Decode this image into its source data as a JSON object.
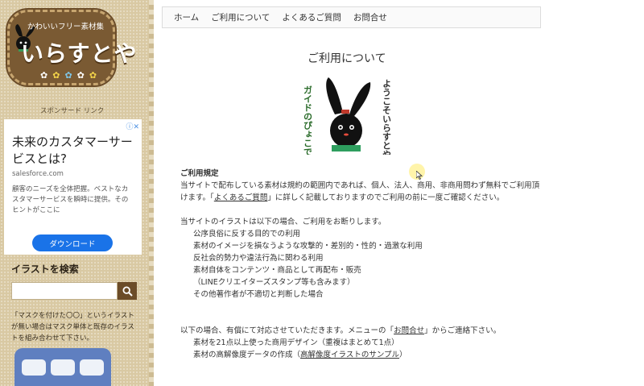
{
  "logo": {
    "subtitle": "かわいいフリー素材集",
    "title": "いらすとや",
    "flowers": [
      "✿",
      "✿",
      "✿",
      "✿",
      "✿",
      "✿"
    ]
  },
  "sidebar": {
    "sponsored_label": "スポンサード リンク",
    "ad": {
      "badge": "ⓘ✕",
      "title": "未来のカスタマーサービスとは?",
      "domain": "salesforce.com",
      "body": "顧客のニーズを全体把握。ベストなカスタマーサービスを瞬時に提供。そのヒントがここに",
      "button": "ダウンロード"
    },
    "search": {
      "title": "イラストを検索",
      "value": ""
    },
    "mask_note": "「マスクを付けた〇〇」というイラストが無い場合はマスク単体と既存のイラストを組み合わせて下さい。"
  },
  "nav": {
    "items": [
      "ホーム",
      "ご利用について",
      "よくあるご質問",
      "お問合せ"
    ]
  },
  "main": {
    "title": "ご利用について",
    "illustration": {
      "text_right": "ようこそいらすとやへ",
      "text_left": "ガイドのぴょこです"
    },
    "rules": {
      "heading": "ご利用規定",
      "para1_a": "当サイトで配布している素材は規約の範囲内であれば、個人、法人、商用、非商用問わず無料でご利用頂けます。「",
      "para1_link": "よくあるご質問",
      "para1_b": "」に詳しく記載しておりますのでご利用の前に一度ご確認ください。",
      "refuse_intro": "当サイトのイラストは以下の場合、ご利用をお断りします。",
      "refuse_items": [
        "公序良俗に反する目的での利用",
        "素材のイメージを損なうような攻撃的・差別的・性的・過激な利用",
        "反社会的勢力や違法行為に関わる利用",
        "素材自体をコンテンツ・商品として再配布・販売",
        "（LINEクリエイターズスタンプ等も含みます）",
        "その他著作者が不適切と判断した場合"
      ],
      "paid_a": "以下の場合、有償にて対応させていただきます。メニューの「",
      "paid_link": "お問合せ",
      "paid_b": "」からご連絡下さい。",
      "paid_item1": "素材を21点以上使った商用デザイン（重複はまとめて1点）",
      "paid_item2_a": "素材の高解像度データの作成（",
      "paid_item2_link": "高解像度イラストのサンプル",
      "paid_item2_b": "）"
    }
  }
}
